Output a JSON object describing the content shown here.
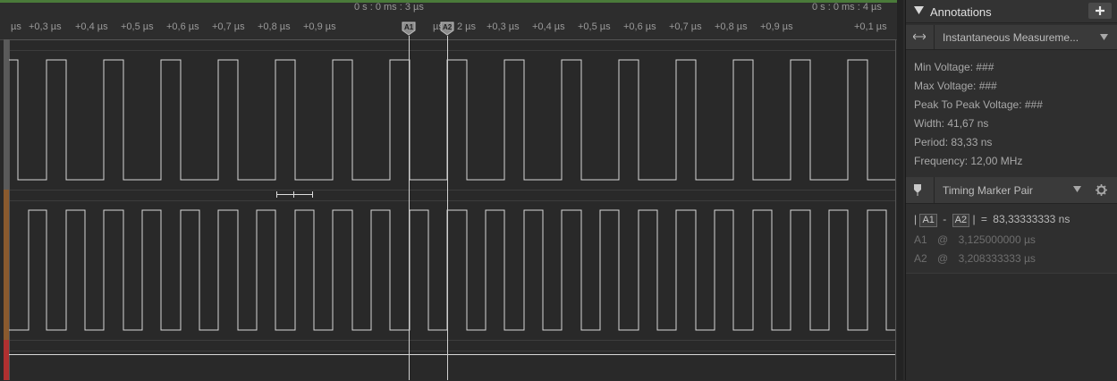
{
  "timeline": {
    "left_ticks": [
      "µs",
      "+0,3 µs",
      "+0,4 µs",
      "+0,5 µs",
      "+0,6 µs",
      "+0,7 µs",
      "+0,8 µs",
      "+0,9 µs"
    ],
    "mid_tick": "µs",
    "right_ticks": [
      "2 µs",
      "+0,3 µs",
      "+0,4 µs",
      "+0,5 µs",
      "+0,6 µs",
      "+0,7 µs",
      "+0,8 µs",
      "+0,9 µs"
    ],
    "far_right_tick": "+0,1 µs",
    "label_mid": "0 s : 0 ms : 3 µs",
    "label_right": "0 s : 0 ms : 4 µs",
    "marker_a1": "A1",
    "marker_a2": "A2"
  },
  "panel": {
    "title": "Annotations",
    "add_icon": "plus-icon",
    "measurement": {
      "title": "Instantaneous Measureme...",
      "icon": "double-arrow-icon",
      "items": [
        "Min Voltage: ###",
        "Max Voltage: ###",
        "Peak To Peak Voltage: ###",
        "Width: 41,67 ns",
        "Period: 83,33 ns",
        "Frequency: 12,00 MHz"
      ]
    },
    "timing": {
      "title": "Timing Marker Pair",
      "icon": "marker-pin-icon",
      "settings_icon": "gear-icon",
      "a1": "A1",
      "a2": "A2",
      "pipe": "|",
      "minus": "-",
      "equals": "=",
      "diff": "83,33333333 ns",
      "at": "@",
      "a1_value": "3,125000000 µs",
      "a2_value": "3,208333333 µs"
    }
  },
  "colors": {
    "channel0": "#5a5a5a",
    "channel1": "#8a5a2e",
    "channel2": "#b03030",
    "accent_green": "#4a7a3a"
  }
}
